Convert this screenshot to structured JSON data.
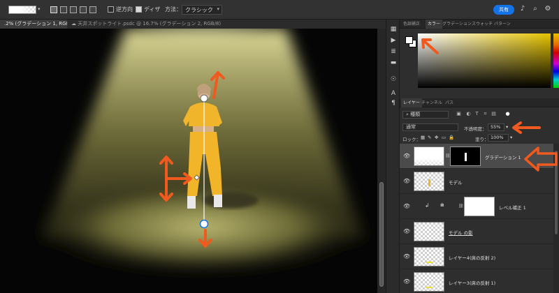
{
  "options_bar": {
    "reverse_label": "逆方向",
    "dither_label": "ディザ",
    "method_label": "方法：",
    "method_value": "クラシック",
    "share_label": "共有"
  },
  "doc_tabs": [
    {
      "label": ".2% (グラデーション 1, RGB/8) *"
    },
    {
      "label": "天井スポットライト.psdc @ 16.7% (グラデーション 2, RGB/8)"
    }
  ],
  "color_panel": {
    "tabs": [
      "色調補正",
      "カラー",
      "グラデーション",
      "スウォッチ",
      "パターン"
    ],
    "active_tab": 1,
    "hue_color": "#e6c400"
  },
  "layers_panel": {
    "tabs": [
      "レイヤー",
      "チャンネル",
      "パス"
    ],
    "kind_label": "種類",
    "blend_mode": "通常",
    "opacity_label": "不透明度：",
    "opacity_value": "55%",
    "lock_label": "ロック：",
    "fill_label": "塗り：",
    "fill_value": "100%",
    "layers": [
      {
        "name": "グラデーション 1",
        "selected": true
      },
      {
        "name": "モデル",
        "selected": false
      },
      {
        "name": "レベル補正 1",
        "selected": false
      },
      {
        "name": "モデル の影",
        "selected": false
      },
      {
        "name": "レイヤー4(床の反射 2)",
        "selected": false
      },
      {
        "name": "レイヤー3(床の反射 1)",
        "selected": false
      }
    ]
  },
  "colors": {
    "accent": "#1473e6",
    "annotation": "#f05a1e",
    "spotlight": "#d8d48a"
  },
  "icons": [
    "gradient-swatch-icon",
    "linear-gradient-icon",
    "radial-gradient-icon",
    "angle-gradient-icon",
    "reflected-gradient-icon",
    "diamond-gradient-icon",
    "bell-icon",
    "search-icon",
    "gear-icon",
    "eye-icon",
    "chain-link-icon"
  ]
}
